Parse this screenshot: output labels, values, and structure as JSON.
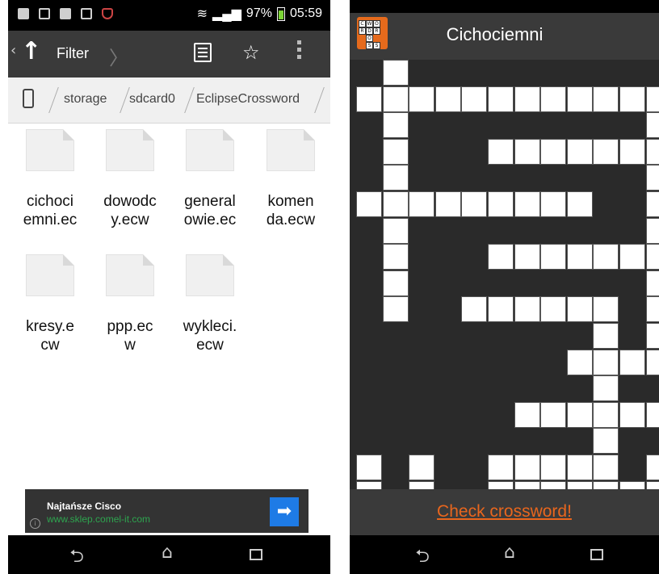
{
  "left": {
    "status": {
      "signal": "97%",
      "time": "05:59"
    },
    "actionbar": {
      "back_glyph": "‹",
      "up_glyph": "↑",
      "title": "Filter",
      "chevron": "〉",
      "list_icon": "list-icon",
      "star": "☆"
    },
    "breadcrumb": [
      "storage",
      "sdcard0",
      "EclipseCrossword"
    ],
    "files": [
      "cichociemni.ec",
      "dowodcy.ecw",
      "generalowie.ec",
      "komenda.ecw",
      "kresy.ecw",
      "ppp.ecw",
      "wykleci.ecw"
    ],
    "files_display": [
      [
        "cichoci",
        "emni.ec"
      ],
      [
        "dowodc",
        "y.ecw"
      ],
      [
        "general",
        "owie.ec"
      ],
      [
        "komen",
        "da.ecw"
      ],
      [
        "kresy.e",
        "cw"
      ],
      [
        "ppp.ec",
        "w"
      ],
      [
        "wykleci.",
        "ecw"
      ]
    ],
    "ad": {
      "title": "Najtańsze Cisco",
      "url": "www.sklep.comel-it.com",
      "info": "i",
      "button_glyph": "➡"
    }
  },
  "right": {
    "title": "Cichociemni",
    "logo_letters": [
      "C",
      "W",
      "O",
      "R",
      "D",
      "R",
      "O",
      "S",
      "S"
    ],
    "check_button": "Check crossword!",
    "white_cells": [
      [
        0,
        1
      ],
      [
        1,
        0
      ],
      [
        1,
        1
      ],
      [
        1,
        2
      ],
      [
        1,
        3
      ],
      [
        1,
        4
      ],
      [
        1,
        5
      ],
      [
        1,
        6
      ],
      [
        1,
        7
      ],
      [
        1,
        8
      ],
      [
        1,
        9
      ],
      [
        1,
        10
      ],
      [
        1,
        11
      ],
      [
        2,
        1
      ],
      [
        2,
        11
      ],
      [
        3,
        1
      ],
      [
        3,
        5
      ],
      [
        3,
        6
      ],
      [
        3,
        7
      ],
      [
        3,
        8
      ],
      [
        3,
        9
      ],
      [
        3,
        10
      ],
      [
        3,
        11
      ],
      [
        4,
        1
      ],
      [
        4,
        11
      ],
      [
        5,
        0
      ],
      [
        5,
        1
      ],
      [
        5,
        2
      ],
      [
        5,
        3
      ],
      [
        5,
        4
      ],
      [
        5,
        5
      ],
      [
        5,
        6
      ],
      [
        5,
        7
      ],
      [
        5,
        8
      ],
      [
        5,
        11
      ],
      [
        6,
        1
      ],
      [
        6,
        11
      ],
      [
        7,
        1
      ],
      [
        7,
        5
      ],
      [
        7,
        6
      ],
      [
        7,
        7
      ],
      [
        7,
        8
      ],
      [
        7,
        9
      ],
      [
        7,
        10
      ],
      [
        7,
        11
      ],
      [
        8,
        1
      ],
      [
        8,
        11
      ],
      [
        9,
        1
      ],
      [
        9,
        4
      ],
      [
        9,
        5
      ],
      [
        9,
        6
      ],
      [
        9,
        7
      ],
      [
        9,
        8
      ],
      [
        9,
        9
      ],
      [
        9,
        11
      ],
      [
        10,
        9
      ],
      [
        10,
        11
      ],
      [
        11,
        8
      ],
      [
        11,
        9
      ],
      [
        11,
        10
      ],
      [
        11,
        11
      ],
      [
        12,
        9
      ],
      [
        13,
        6
      ],
      [
        13,
        7
      ],
      [
        13,
        8
      ],
      [
        13,
        9
      ],
      [
        13,
        10
      ],
      [
        13,
        11
      ],
      [
        14,
        9
      ],
      [
        15,
        0
      ],
      [
        15,
        2
      ],
      [
        15,
        5
      ],
      [
        15,
        6
      ],
      [
        15,
        7
      ],
      [
        15,
        8
      ],
      [
        15,
        9
      ],
      [
        15,
        11
      ],
      [
        16,
        0
      ],
      [
        16,
        2
      ],
      [
        16,
        5
      ],
      [
        16,
        6
      ],
      [
        16,
        7
      ],
      [
        16,
        8
      ],
      [
        16,
        9
      ],
      [
        16,
        10
      ],
      [
        16,
        11
      ]
    ]
  },
  "nav": {
    "back": "⮌",
    "home": "⌂"
  }
}
